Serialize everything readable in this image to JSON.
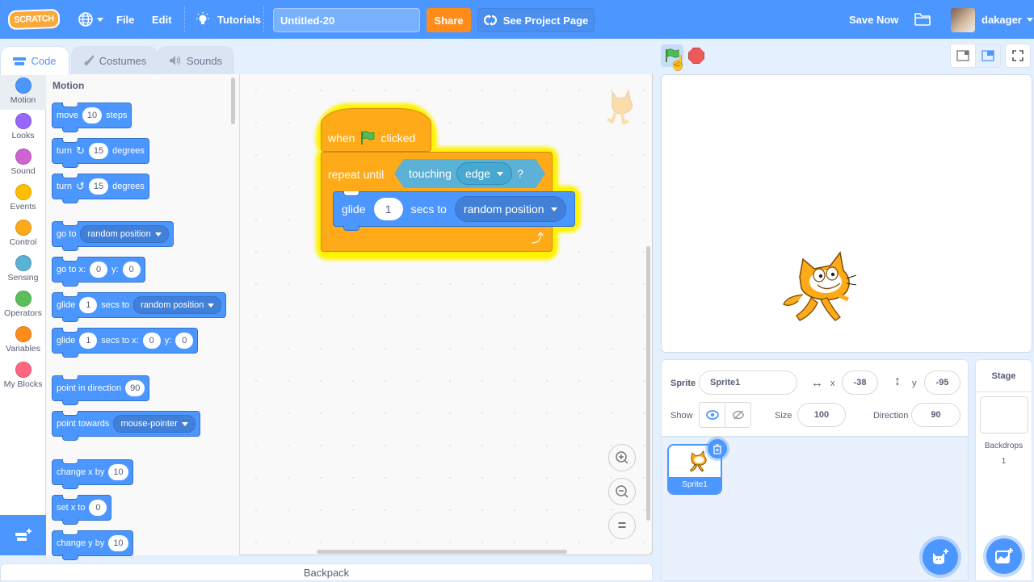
{
  "menubar": {
    "logo": "SCRATCH",
    "language_icon": "globe-icon",
    "file": "File",
    "edit": "Edit",
    "tutorials": "Tutorials",
    "project_title": "Untitled-20",
    "share": "Share",
    "see_project_page": "See Project Page",
    "save_now": "Save Now",
    "username": "dakager"
  },
  "tabs": [
    {
      "label": "Code",
      "active": true
    },
    {
      "label": "Costumes",
      "active": false
    },
    {
      "label": "Sounds",
      "active": false
    }
  ],
  "categories": [
    {
      "label": "Motion",
      "color": "#4c97ff",
      "selected": true
    },
    {
      "label": "Looks",
      "color": "#9966ff"
    },
    {
      "label": "Sound",
      "color": "#cf63cf"
    },
    {
      "label": "Events",
      "color": "#ffbf00"
    },
    {
      "label": "Control",
      "color": "#ffab19"
    },
    {
      "label": "Sensing",
      "color": "#5cb1d6"
    },
    {
      "label": "Operators",
      "color": "#59c059"
    },
    {
      "label": "Variables",
      "color": "#ff8c1a"
    },
    {
      "label": "My Blocks",
      "color": "#ff6680"
    }
  ],
  "palette": {
    "heading": "Motion",
    "blocks": {
      "move": {
        "a": "move",
        "v": "10",
        "b": "steps"
      },
      "turn_right": {
        "a": "turn",
        "v": "15",
        "b": "degrees"
      },
      "turn_left": {
        "a": "turn",
        "v": "15",
        "b": "degrees"
      },
      "goto": {
        "a": "go to",
        "dd": "random position"
      },
      "goto_xy": {
        "a": "go to x:",
        "x": "0",
        "b": "y:",
        "y": "0"
      },
      "glide": {
        "a": "glide",
        "v": "1",
        "b": "secs to",
        "dd": "random position"
      },
      "glide_xy": {
        "a": "glide",
        "v": "1",
        "b": "secs to x:",
        "x": "0",
        "c": "y:",
        "y": "0"
      },
      "point_dir": {
        "a": "point in direction",
        "v": "90"
      },
      "point_towards": {
        "a": "point towards",
        "dd": "mouse-pointer"
      },
      "change_x": {
        "a": "change x by",
        "v": "10"
      },
      "set_x": {
        "a": "set x to",
        "v": "0"
      },
      "change_y": {
        "a": "change y by",
        "v": "10"
      }
    }
  },
  "script": {
    "hat": {
      "a": "when",
      "b": "clicked"
    },
    "repeat": {
      "a": "repeat until",
      "touching": "touching",
      "target": "edge",
      "q": "?"
    },
    "glide": {
      "a": "glide",
      "v": "1",
      "b": "secs to",
      "dd": "random position"
    }
  },
  "workspace_zoom": {
    "in": "zoom-in",
    "out": "zoom-out",
    "reset": "="
  },
  "sprite_info": {
    "sprite_label": "Sprite",
    "sprite_name": "Sprite1",
    "x_label": "x",
    "x": "-38",
    "y_label": "y",
    "y": "-95",
    "show_label": "Show",
    "size_label": "Size",
    "size": "100",
    "direction_label": "Direction",
    "direction": "90"
  },
  "sprites": [
    {
      "name": "Sprite1",
      "selected": true
    }
  ],
  "stage_panel": {
    "title": "Stage",
    "backdrops_label": "Backdrops",
    "backdrops_count": "1"
  },
  "backpack": "Backpack"
}
